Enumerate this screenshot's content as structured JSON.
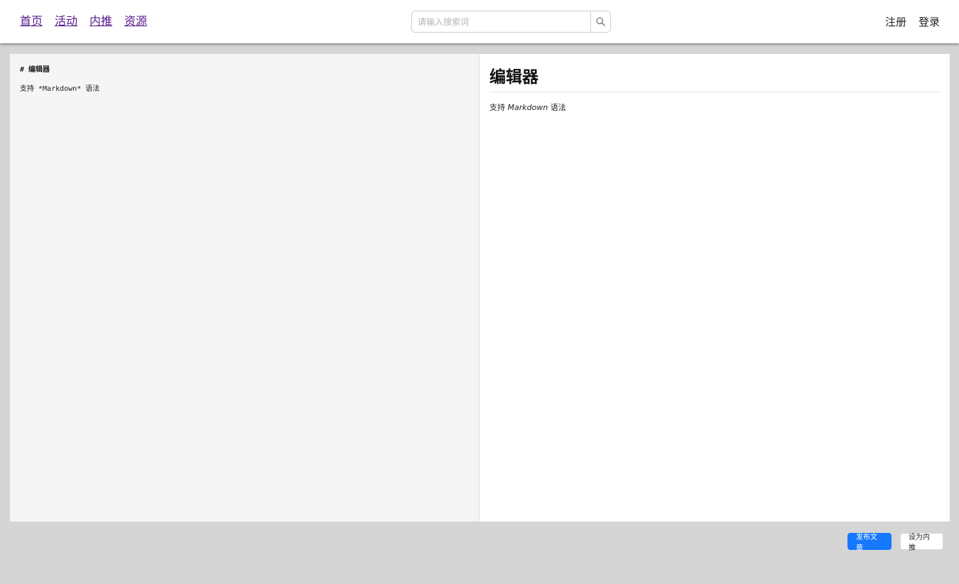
{
  "header": {
    "nav": [
      {
        "label": "首页"
      },
      {
        "label": "活动"
      },
      {
        "label": "内推"
      },
      {
        "label": "资源"
      }
    ],
    "search": {
      "placeholder": "请输入搜索词",
      "value": ""
    },
    "auth": {
      "register": "注册",
      "login": "登录"
    }
  },
  "editor": {
    "source_lines": [
      "# 编辑器",
      "支持 *Markdown* 语法"
    ],
    "preview": {
      "heading": "编辑器",
      "text_before": "支持 ",
      "text_emphasis": "Markdown",
      "text_after": " 语法"
    }
  },
  "actions": {
    "publish": "发布文章",
    "set_referral": "设为内推"
  },
  "colors": {
    "primary": "#1677ff",
    "link": "#551a8b",
    "background": "#d5d5d5"
  }
}
